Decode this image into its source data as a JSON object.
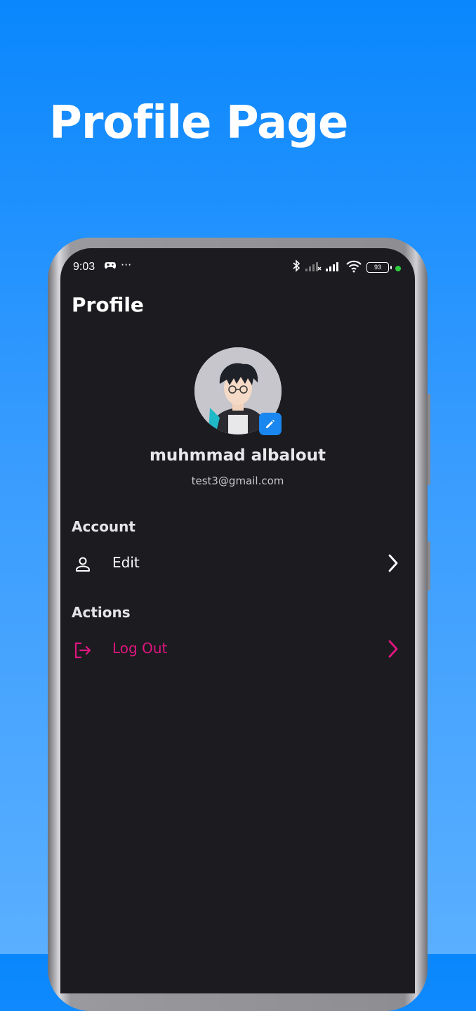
{
  "promo": {
    "headline": "Profile Page"
  },
  "status_bar": {
    "time": "9:03",
    "battery": "93"
  },
  "page": {
    "title": "Profile"
  },
  "user": {
    "name": "muhmmad albalout",
    "email": "test3@gmail.com"
  },
  "sections": {
    "account": {
      "title": "Account",
      "items": [
        {
          "label": "Edit",
          "icon": "person-icon"
        }
      ]
    },
    "actions": {
      "title": "Actions",
      "items": [
        {
          "label": "Log Out",
          "icon": "logout-icon"
        }
      ]
    }
  },
  "colors": {
    "accent": "#1a86ef",
    "danger": "#e0157f",
    "background": "#1b1b20"
  }
}
